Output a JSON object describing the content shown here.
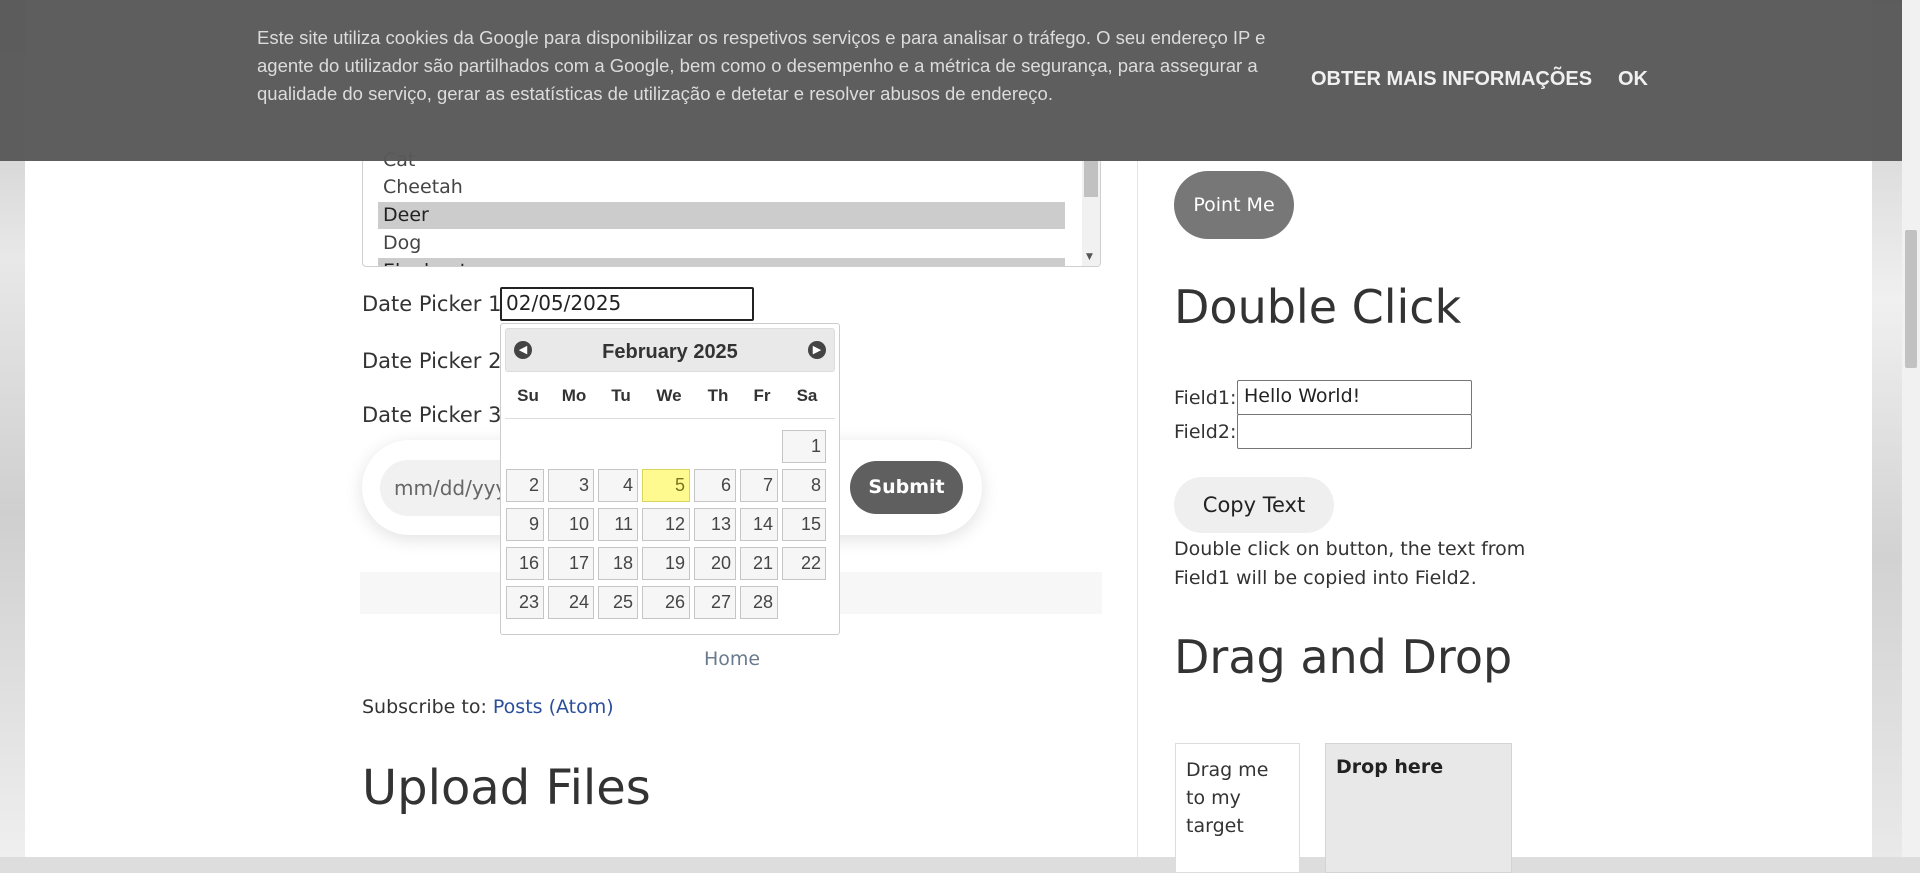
{
  "cookie_banner": {
    "text": "Este site utiliza cookies da Google para disponibilizar os respetivos serviços e para analisar o tráfego. O seu endereço IP e agente do utilizador são partilhados com a Google, bem como o desempenho e a métrica de segurança, para assegurar a qualidade do serviço, gerar as estatísticas de utilização e detetar e resolver abusos de endereço.",
    "more_info": "OBTER MAIS INFORMAÇÕES",
    "ok": "OK"
  },
  "animal_list": {
    "options": [
      "Cat",
      "Cheetah",
      "Deer",
      "Dog",
      "Elephant"
    ],
    "selected": [
      "Deer",
      "Elephant"
    ]
  },
  "date_pickers": {
    "label1": "Date Picker 1:",
    "value1": "02/05/2025",
    "label2": "Date Picker 2:",
    "label3": "Date Picker 3:",
    "placeholder3": "mm/dd/yyyy",
    "submit": "Submit"
  },
  "calendar": {
    "title": "February 2025",
    "prev": "◀",
    "next": "▶",
    "weekdays": [
      "Su",
      "Mo",
      "Tu",
      "We",
      "Th",
      "Fr",
      "Sa"
    ],
    "days": [
      "1",
      "2",
      "3",
      "4",
      "5",
      "6",
      "7",
      "8",
      "9",
      "10",
      "11",
      "12",
      "13",
      "14",
      "15",
      "16",
      "17",
      "18",
      "19",
      "20",
      "21",
      "22",
      "23",
      "24",
      "25",
      "26",
      "27",
      "28"
    ],
    "highlighted_day": "5"
  },
  "footer": {
    "home": "Home",
    "subscribe_label": "Subscribe to: ",
    "subscribe_link": "Posts (Atom)",
    "upload_heading": "Upload Files"
  },
  "sidebar": {
    "point_me": "Point Me",
    "double_click_heading": "Double Click",
    "field1_label": "Field1:",
    "field1_value": "Hello World!",
    "field2_label": "Field2:",
    "field2_value": "",
    "copy_button": "Copy Text",
    "help_text": "Double click on button, the text from Field1 will be copied into Field2.",
    "drag_heading": "Drag and Drop",
    "drag_text": "Drag me to my target",
    "drop_text": "Drop here"
  }
}
